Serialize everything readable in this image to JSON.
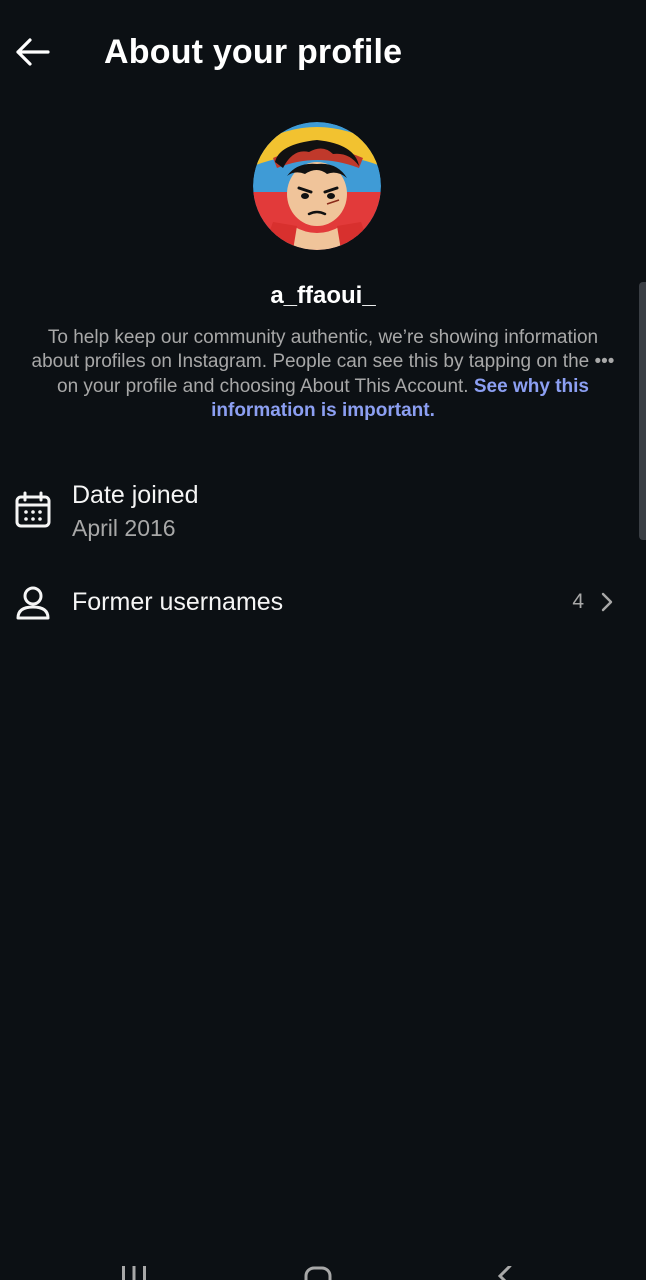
{
  "header": {
    "title": "About your profile",
    "back_icon": "arrow-left-icon"
  },
  "profile": {
    "username": "a_ffaoui_",
    "avatar_icon": "profile-avatar"
  },
  "info": {
    "text_before_dots": "To help keep our community authentic, we’re showing information about profiles on Instagram. People can see this by tapping on the ",
    "dots": "•••",
    "text_after_dots": " on your profile and choosing About This Account. ",
    "link": "See why this information is important."
  },
  "rows": {
    "date_joined": {
      "title": "Date joined",
      "value": "April 2016",
      "icon": "calendar-icon"
    },
    "former_usernames": {
      "title": "Former usernames",
      "count": "4",
      "icon": "person-icon",
      "chevron_icon": "chevron-right-icon"
    }
  },
  "colors": {
    "background": "#0c1014",
    "primary_text": "#f5f5f5",
    "secondary_text": "#a8a8a8",
    "link": "#8c9ff2"
  }
}
